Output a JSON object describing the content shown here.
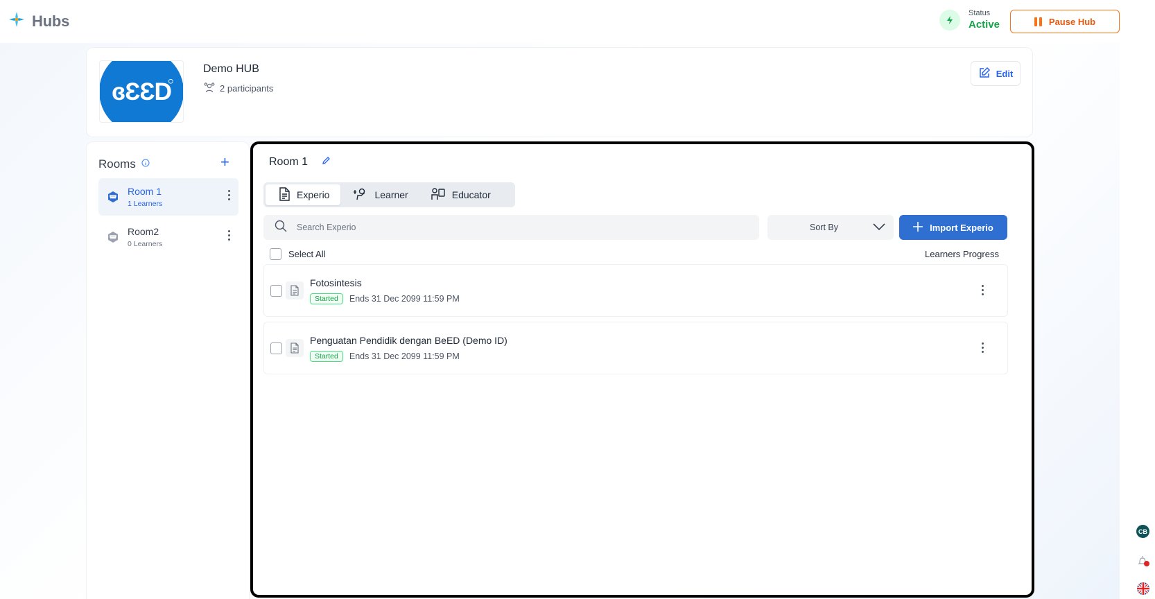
{
  "app": {
    "title": "Hubs"
  },
  "status": {
    "label": "Status",
    "value": "Active"
  },
  "pause_button": {
    "label": "Pause Hub"
  },
  "hub": {
    "logo_text": "ƐƐD",
    "logo_prefix": "B",
    "name": "Demo HUB",
    "participants": "2 participants",
    "edit_label": "Edit"
  },
  "rooms": {
    "title": "Rooms",
    "items": [
      {
        "name": "Room 1",
        "count": "1 Learners",
        "active": true
      },
      {
        "name": "Room2",
        "count": "0 Learners",
        "active": false
      }
    ]
  },
  "main": {
    "room_title": "Room 1",
    "tabs": [
      {
        "label": "Experio",
        "icon": "document-icon"
      },
      {
        "label": "Learner",
        "icon": "learner-icon"
      },
      {
        "label": "Educator",
        "icon": "educator-icon"
      }
    ],
    "search": {
      "placeholder": "Search Experio"
    },
    "sort": {
      "label": "Sort By"
    },
    "import_label": "Import Experio",
    "select_all": "Select All",
    "learners_progress": "Learners Progress",
    "experios": [
      {
        "title": "Fotosintesis",
        "status": "Started",
        "ends": "Ends 31 Dec 2099 11:59 PM"
      },
      {
        "title": "Penguatan Pendidik dengan BeED (Demo ID)",
        "status": "Started",
        "ends": "Ends 31 Dec 2099 11:59 PM"
      }
    ]
  },
  "utilities": {
    "avatar_initials": "CB"
  },
  "colors": {
    "accent": "#2f6fd1",
    "active_status": "#16a34a",
    "pause": "#f97316",
    "logo_bg": "#1079d4"
  }
}
